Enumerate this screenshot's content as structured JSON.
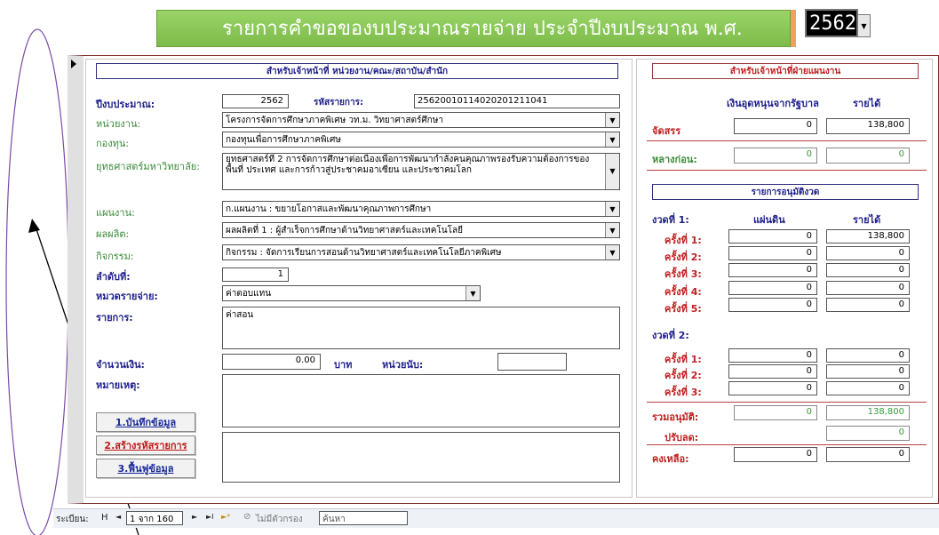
{
  "title_banner": "รายการคำขอของบประมาณรายจ่าย ประจำปีงบประมาณ พ.ศ.",
  "year_select": {
    "value": "2562"
  },
  "left_section": {
    "header": "สำหรับเจ้าหน้าที่ หน่วยงาน/คณะ/สถาบัน/สำนัก",
    "fiscal_year_label": "ปีงบประมาณ:",
    "fiscal_year_value": "2562",
    "item_code_label": "รหัสรายการ:",
    "item_code_value": "2562001011402020121104​1",
    "unit_label": "หน่วยงาน:",
    "unit_value": "โครงการจัดการศึกษาภาคพิเศษ วท.ม. วิทยาศาสตร์ศึกษา",
    "fund_label": "กองทุน:",
    "fund_value": "กองทุนเพื่อการศึกษาภาคพิเศษ",
    "strategy_label": "ยุทธศาสตร์มหาวิทยาลัย:",
    "strategy_value": "ยุทธศาสตร์ที่ 2 การจัดการศึกษาต่อเนื่องเพื่อการพัฒนากำลังคนคุณภาพรองรับความต้องการของพื้นที่ ประเทศ และการก้าวสู่ประชาคมอาเซียน และประชาคมโลก",
    "plan_label": "แผนงาน:",
    "plan_value": "ก.แผนงาน : ขยายโอกาสและพัฒนาคุณภาพการศึกษา",
    "output_label": "ผลผลิต:",
    "output_value": "ผลผลิตที่ 1 : ผู้สำเร็จการศึกษาด้านวิทยาศาสตร์และเทคโนโลยี",
    "activity_label": "กิจกรรม:",
    "activity_value": "กิจกรรม : จัดการเรียนการสอนด้านวิทยาศาสตร์และเทคโนโลยีภาคพิเศษ",
    "sequence_label": "ลำดับที่:",
    "sequence_value": "1",
    "category_label": "หมวดรายจ่าย:",
    "category_value": "ค่าตอบแทน",
    "item_label": "รายการ:",
    "item_value": "ค่าสอน",
    "amount_label": "จำนวนเงิน:",
    "amount_value": "0.00",
    "baht_label": "บาท",
    "unit_count_label": "หน่วยนับ:",
    "unit_count_value": "",
    "note_label": "หมายเหตุ:",
    "note_value": "",
    "btn_save": "1.บันทึกข้อมูล",
    "btn_create": "2.สร้างรหัสรายการ",
    "btn_restore": "3.ฟื้นฟูข้อมูล"
  },
  "right_section": {
    "header": "สำหรับเจ้าหน้าที่ฝ่ายแผนงาน",
    "col_gov": "เงินอุดหนุนจากรัฐบาล",
    "col_income": "รายได้",
    "allocate_label": "จัดสรร",
    "allocate_gov": "0",
    "allocate_income": "138,800",
    "previous_label": "หลางก่อน:",
    "previous_gov": "0",
    "previous_income": "0",
    "approval_header": "รายการอนุมัติงวด",
    "period1_label": "งวดที่ 1:",
    "col_land": "แผ่นดิน",
    "col_income2": "รายได้",
    "period1_rows": [
      {
        "label": "ครั้งที่ 1:",
        "land": "0",
        "income": "138,800"
      },
      {
        "label": "ครั้งที่ 2:",
        "land": "0",
        "income": "0"
      },
      {
        "label": "ครั้งที่ 3:",
        "land": "0",
        "income": "0"
      },
      {
        "label": "ครั้งที่ 4:",
        "land": "0",
        "income": "0"
      },
      {
        "label": "ครั้งที่ 5:",
        "land": "0",
        "income": "0"
      }
    ],
    "period2_label": "งวดที่ 2:",
    "period2_rows": [
      {
        "label": "ครั้งที่ 1:",
        "land": "0",
        "income": "0"
      },
      {
        "label": "ครั้งที่ 2:",
        "land": "0",
        "income": "0"
      },
      {
        "label": "ครั้งที่ 3:",
        "land": "0",
        "income": "0"
      }
    ],
    "total_label": "รวมอนุมัติ:",
    "total_land": "0",
    "total_income": "138,800",
    "adjust_label": "ปรับลด:",
    "adjust_value": "0",
    "remain_label": "คงเหลือ:",
    "remain_land": "0",
    "remain_income": "0"
  },
  "nav_bar": {
    "record_label": "ระเบียน:",
    "first": "H",
    "prev": "◄",
    "current": "1",
    "of_text": "จาก 160",
    "next": "►",
    "last": "►I",
    "new": "►*",
    "filter": "ไม่มีตัวกรอง",
    "search": "ค้นหา"
  },
  "colors": {
    "banner_green": "#8cc858",
    "frame_border": "#7a2a2a",
    "section_border": "#9b3a3a",
    "label_blue": "#20208c",
    "label_green": "#3a8a3a",
    "label_red": "#c02020"
  }
}
